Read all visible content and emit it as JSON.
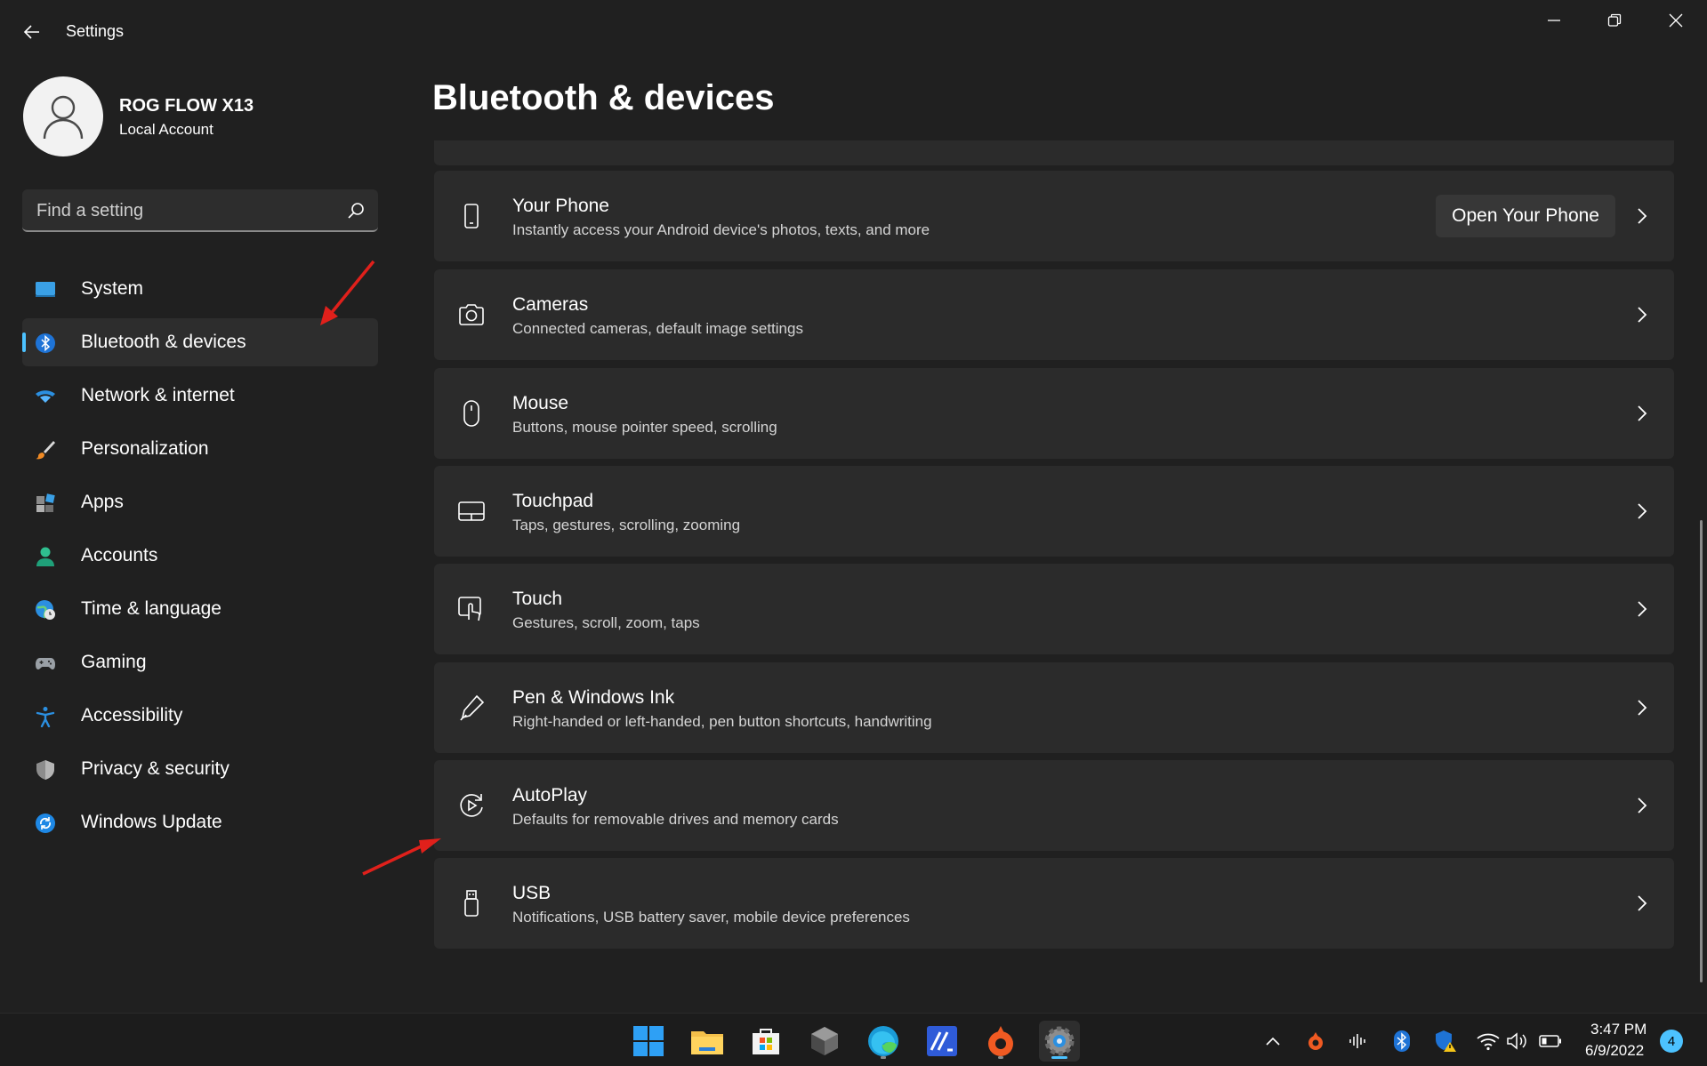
{
  "app": {
    "title": "Settings"
  },
  "profile": {
    "name": "ROG FLOW X13",
    "account_type": "Local Account"
  },
  "search": {
    "placeholder": "Find a setting"
  },
  "sidebar": {
    "items": [
      {
        "label": "System",
        "icon": "system-icon",
        "active": false
      },
      {
        "label": "Bluetooth & devices",
        "icon": "bluetooth-icon",
        "active": true
      },
      {
        "label": "Network & internet",
        "icon": "wifi-icon",
        "active": false
      },
      {
        "label": "Personalization",
        "icon": "brush-icon",
        "active": false
      },
      {
        "label": "Apps",
        "icon": "apps-icon",
        "active": false
      },
      {
        "label": "Accounts",
        "icon": "person-icon",
        "active": false
      },
      {
        "label": "Time & language",
        "icon": "globe-clock-icon",
        "active": false
      },
      {
        "label": "Gaming",
        "icon": "gamepad-icon",
        "active": false
      },
      {
        "label": "Accessibility",
        "icon": "accessibility-icon",
        "active": false
      },
      {
        "label": "Privacy & security",
        "icon": "shield-icon",
        "active": false
      },
      {
        "label": "Windows Update",
        "icon": "update-icon",
        "active": false
      }
    ]
  },
  "main": {
    "page_title": "Bluetooth & devices",
    "cards": [
      {
        "title": "Your Phone",
        "desc": "Instantly access your Android device's photos, texts, and more",
        "icon": "phone-icon",
        "action": "Open Your Phone"
      },
      {
        "title": "Cameras",
        "desc": "Connected cameras, default image settings",
        "icon": "camera-icon"
      },
      {
        "title": "Mouse",
        "desc": "Buttons, mouse pointer speed, scrolling",
        "icon": "mouse-icon"
      },
      {
        "title": "Touchpad",
        "desc": "Taps, gestures, scrolling, zooming",
        "icon": "touchpad-icon"
      },
      {
        "title": "Touch",
        "desc": "Gestures, scroll, zoom, taps",
        "icon": "touch-icon"
      },
      {
        "title": "Pen & Windows Ink",
        "desc": "Right-handed or left-handed, pen button shortcuts, handwriting",
        "icon": "pen-icon"
      },
      {
        "title": "AutoPlay",
        "desc": "Defaults for removable drives and memory cards",
        "icon": "autoplay-icon"
      },
      {
        "title": "USB",
        "desc": "Notifications, USB battery saver, mobile device preferences",
        "icon": "usb-icon"
      }
    ]
  },
  "taskbar": {
    "apps": [
      "start-icon",
      "file-explorer-icon",
      "store-icon",
      "app-icon",
      "edge-icon",
      "app-icon",
      "origin-icon",
      "settings-icon"
    ],
    "clock": {
      "time": "3:47 PM",
      "date": "6/9/2022"
    },
    "notification_count": "4"
  },
  "colors": {
    "accent": "#4cc2ff",
    "background": "#202020",
    "card": "#2b2b2b",
    "annotation_arrow": "#e0201b"
  }
}
